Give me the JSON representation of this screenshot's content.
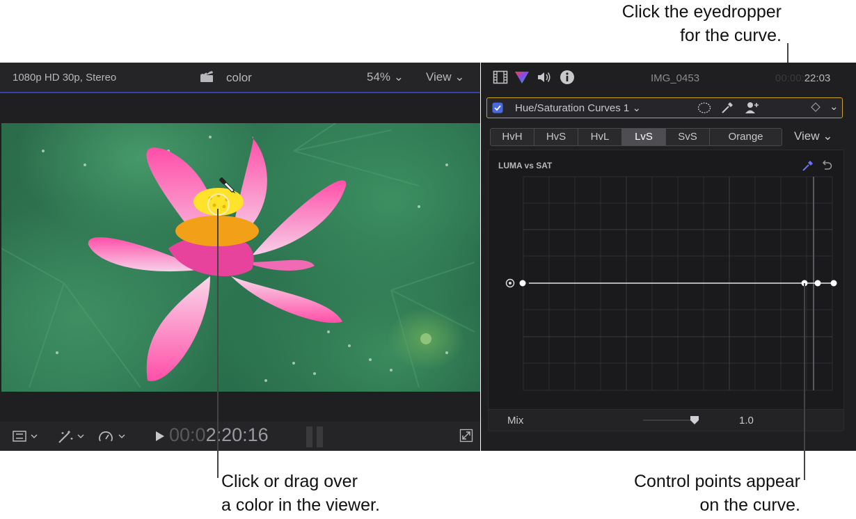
{
  "callouts": {
    "top_right": [
      "Click the eyedropper",
      "for the curve."
    ],
    "bottom_left": [
      "Click or drag over",
      "a color in the viewer."
    ],
    "bottom_right": [
      "Control points appear",
      "on the curve."
    ]
  },
  "viewer": {
    "format": "1080p HD 30p, Stereo",
    "clip_name": "color",
    "zoom": "54%",
    "view_label": "View",
    "timecode_dim": "00:0",
    "timecode_bright": "2:20:16"
  },
  "inspector": {
    "clip_name": "IMG_0453",
    "timecode_dim": "00:00:",
    "timecode_bright": "22:03",
    "effect_name": "Hue/Saturation Curves 1",
    "effect_enabled": true,
    "tabs": [
      "HvH",
      "HvS",
      "HvL",
      "LvS",
      "SvS",
      "Orange"
    ],
    "selected_tab": "LvS",
    "view_label": "View",
    "curve_title": "LUMA vs SAT",
    "mix_label": "Mix",
    "mix_value": "1.0",
    "colors": {
      "accent_gold": "#c9a227",
      "eyedropper_blue": "#6b73ff",
      "checkbox_blue": "#4a68e0"
    }
  }
}
